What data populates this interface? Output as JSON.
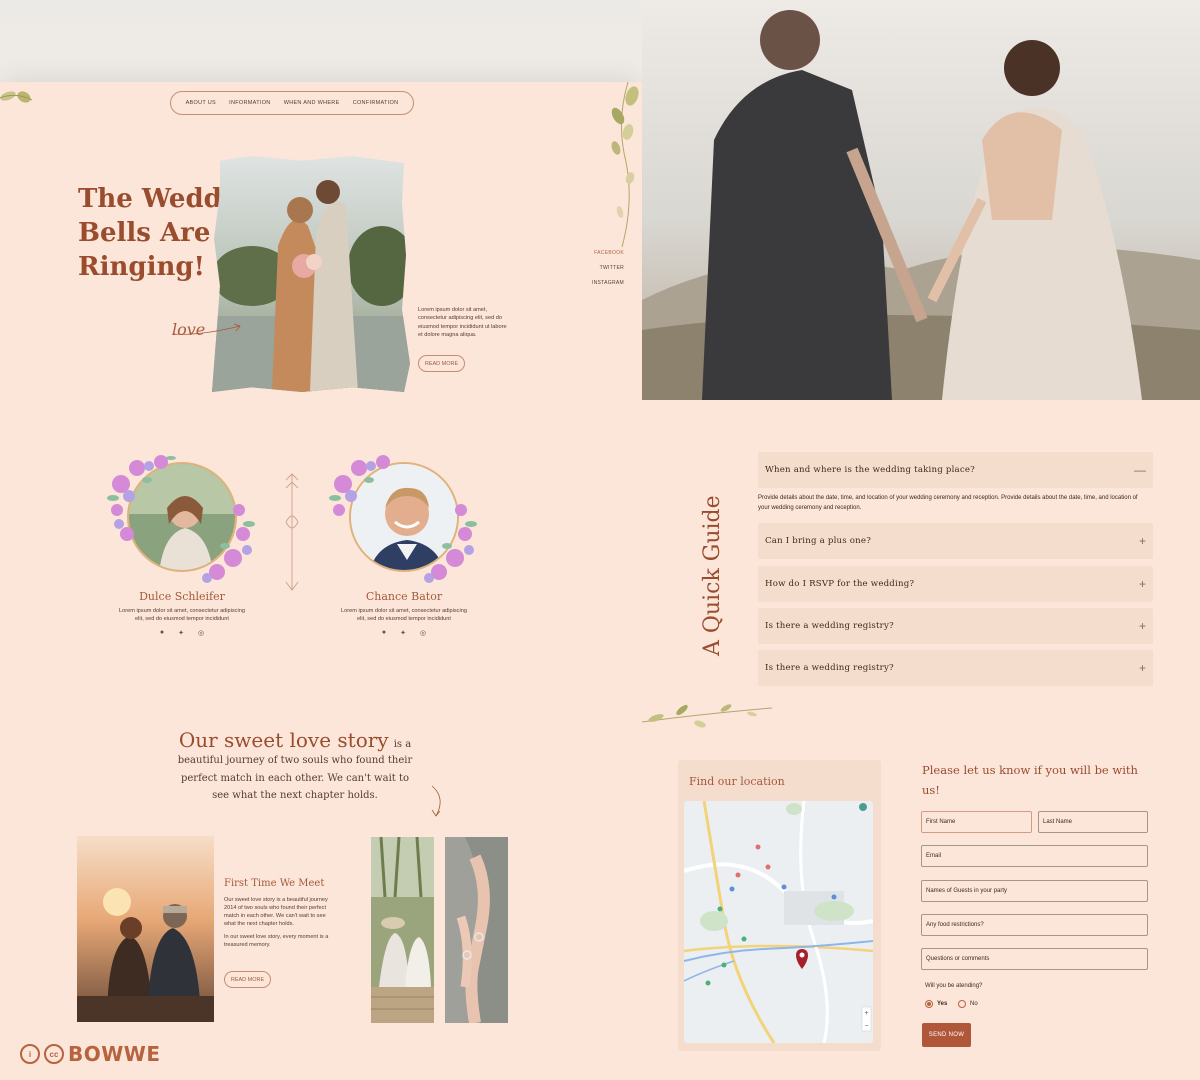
{
  "nav": {
    "items": [
      "ABOUT US",
      "INFORMATION",
      "WHEN AND WHERE",
      "CONFIRMATION"
    ]
  },
  "hero": {
    "title_lines": [
      "The Wedding",
      "Bells Are",
      "Ringing!"
    ],
    "body": "Lorem ipsum dolor sit amet, consectetur adipiscing elit, sed do eiusmod tempor incididunt ut labore et dolore magna aliqua.",
    "read_more": "READ MORE",
    "script_word": "love"
  },
  "social_side": [
    "FACEBOOK",
    "TWITTER",
    "INSTAGRAM"
  ],
  "couple": [
    {
      "name": "Dulce Schleifer",
      "bio": "Lorem ipsum dolor sit amet, consectetur adipiscing elit, sed do eiusmod tempor incididunt"
    },
    {
      "name": "Chance Bator",
      "bio": "Lorem ipsum dolor sit amet, consectetur adipiscing elit, sed do eiusmod tempor incididunt"
    }
  ],
  "story": {
    "heading": "Our sweet love story",
    "heading_tail": "is a",
    "lines": [
      "beautiful journey of two souls who found their",
      "perfect match in each other. We can't wait to",
      "see what the next chapter holds."
    ]
  },
  "first_meet": {
    "title": "First Time We Meet",
    "para1": "Our sweet love story is a beautiful journey 2014 of two souls who found their perfect match in each other. We can't wait to see what the next chapter holds.",
    "para2": "In our sweet love story, every moment is a treasured memory.",
    "read_more": "READ MORE"
  },
  "brand": {
    "name": "BOWWE",
    "icon1": "i",
    "icon2": "cc"
  },
  "guide": {
    "title": "A Quick Guide",
    "faqs": [
      {
        "q": "When and where is the wedding taking place?",
        "open": true
      },
      {
        "q": "Can I bring a plus one?",
        "open": false
      },
      {
        "q": "How do I RSVP for the wedding?",
        "open": false
      },
      {
        "q": "Is there a wedding registry?",
        "open": false
      },
      {
        "q": "Is there a wedding registry?",
        "open": false
      }
    ],
    "answer": "Provide details about the date, time, and location of your wedding ceremony and reception. Provide details about the date, time, and location of your wedding ceremony and reception.",
    "open_sign": "—",
    "closed_sign": "+"
  },
  "location": {
    "title": "Find our location",
    "zoom_in": "+",
    "zoom_out": "−"
  },
  "rsvp": {
    "title": "Please let us know if you will be with us!",
    "fields": {
      "first_name": "First Name",
      "last_name": "Last Name",
      "email": "Email",
      "guests": "Names of Guests in your party",
      "food": "Any food restrictions?",
      "questions": "Questions or comments"
    },
    "attending_q": "Will you be atending?",
    "yes": "Yes",
    "no": "No",
    "yes_selected": true,
    "send": "SEND NOW"
  },
  "colors": {
    "accent": "#9a4c2e",
    "panel": "#fbe6d9",
    "faq_bg": "#f4ddcd",
    "button": "#b0573a"
  }
}
